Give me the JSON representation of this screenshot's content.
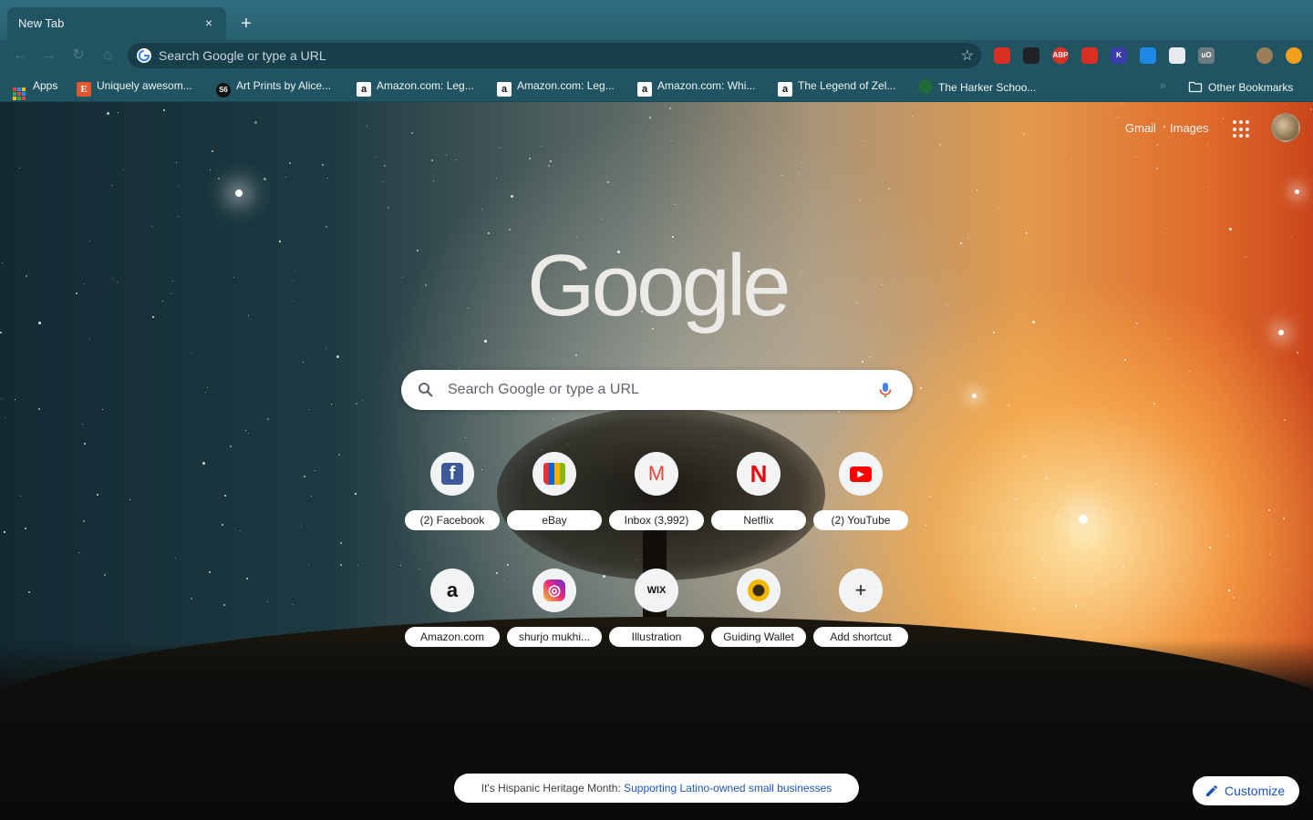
{
  "tab": {
    "title": "New Tab",
    "close_glyph": "×",
    "new_tab_glyph": "+"
  },
  "toolbar": {
    "omnibox_placeholder": "Search Google or type a URL",
    "extensions": [
      {
        "name": "red-book-extension-icon",
        "color": "#d93025",
        "label": ""
      },
      {
        "name": "black-extension-icon",
        "color": "#202124",
        "label": ""
      },
      {
        "name": "adblock-plus-icon",
        "color": "#d93025",
        "label": "ABP"
      },
      {
        "name": "red-hand-extension-icon",
        "color": "#d93025",
        "label": ""
      },
      {
        "name": "k-extension-icon",
        "color": "#3b3da8",
        "label": "K"
      },
      {
        "name": "blue-window-extension-icon",
        "color": "#1e88e5",
        "label": ""
      },
      {
        "name": "document-extension-icon",
        "color": "#e8eaed",
        "label": ""
      },
      {
        "name": "ublock-shield-icon",
        "color": "#6e7b80",
        "label": "uO"
      },
      {
        "name": "puzzle-extensions-icon",
        "color": "#215463",
        "label": ""
      },
      {
        "name": "profile-avatar-icon",
        "color": "#9b7e5a",
        "label": ""
      },
      {
        "name": "update-orange-icon",
        "color": "#f2a01a",
        "label": ""
      }
    ]
  },
  "bookmarks": {
    "items": [
      {
        "label": "Apps",
        "icon": "apps-grid-icon"
      },
      {
        "label": "Uniquely awesom...",
        "icon": "etsy-icon"
      },
      {
        "label": "Art Prints by Alice...",
        "icon": "society6-icon"
      },
      {
        "label": "Amazon.com: Leg...",
        "icon": "amazon-icon"
      },
      {
        "label": "Amazon.com: Leg...",
        "icon": "amazon-icon"
      },
      {
        "label": "Amazon.com: Whi...",
        "icon": "amazon-icon"
      },
      {
        "label": "The Legend of Zel...",
        "icon": "amazon-icon"
      },
      {
        "label": "The Harker Schoo...",
        "icon": "harker-icon"
      }
    ],
    "overflow_glyph": "»",
    "other": "Other Bookmarks"
  },
  "ntp": {
    "gmail": "Gmail",
    "images": "Images",
    "logo": "Google",
    "search_placeholder": "Search Google or type a URL",
    "shortcuts": [
      {
        "title": "(2) Facebook",
        "icon": "facebook-icon",
        "color": "#3b5998",
        "glyph": "f"
      },
      {
        "title": "eBay",
        "icon": "ebay-bag-icon",
        "color": "#f5af02",
        "glyph": ""
      },
      {
        "title": "Inbox (3,992)",
        "icon": "gmail-icon",
        "color": "#ea4335",
        "glyph": "M"
      },
      {
        "title": "Netflix",
        "icon": "netflix-icon",
        "color": "#e50914",
        "glyph": "N"
      },
      {
        "title": "(2) YouTube",
        "icon": "youtube-icon",
        "color": "#ff0000",
        "glyph": "▶"
      },
      {
        "title": "Amazon.com",
        "icon": "amazon-icon",
        "color": "#ffffff",
        "glyph": "a"
      },
      {
        "title": "shurjo mukhi...",
        "icon": "instagram-icon",
        "color": "#c13584",
        "glyph": "◎"
      },
      {
        "title": "Illustration",
        "icon": "wix-icon",
        "color": "#ffffff",
        "glyph": "WIX"
      },
      {
        "title": "Guiding Wallet",
        "icon": "sunflower-icon",
        "color": "#f2b705",
        "glyph": "●"
      },
      {
        "title": "Add shortcut",
        "icon": "plus-icon",
        "color": "#f1f3f4",
        "glyph": "+"
      }
    ],
    "promo_prefix": "It's Hispanic Heritage Month: ",
    "promo_link": "Supporting Latino-owned small businesses",
    "customize": "Customize"
  }
}
